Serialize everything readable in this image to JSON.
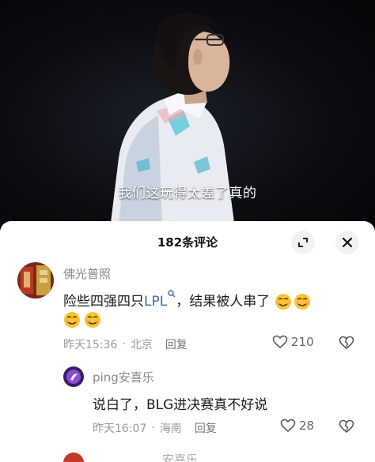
{
  "video": {
    "subtitle": "我们这玩得太差了真的"
  },
  "comments_panel": {
    "title": "182条评论",
    "expand_icon": "expand-icon",
    "close_icon": "close-icon"
  },
  "comments": [
    {
      "username": "佛光普照",
      "text_before": "险些四强四只",
      "link_text": "LPL",
      "text_after": "，结果被人串了",
      "emoji": [
        "sly-smile-emoji",
        "sly-smile-emoji",
        "sly-smile-emoji",
        "sly-smile-emoji"
      ],
      "time": "昨天15:36",
      "location": "北京",
      "reply_label": "回复",
      "likes": "210"
    },
    {
      "username": "ping安喜乐",
      "text": "说白了，BLG进决赛真不好说",
      "time": "昨天16:07",
      "location": "海南",
      "reply_label": "回复",
      "likes": "28"
    }
  ],
  "partial_next": {
    "username_fragment": "安喜乐"
  },
  "separator": "·"
}
